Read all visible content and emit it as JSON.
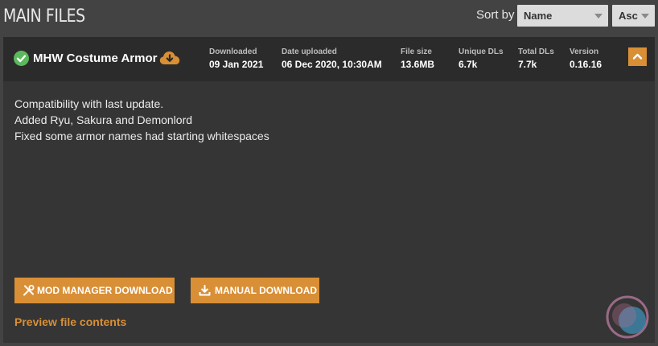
{
  "section": {
    "title": "MAIN FILES"
  },
  "sort": {
    "label": "Sort by",
    "field_selected": "Name",
    "order_selected": "Asc"
  },
  "file": {
    "name": "MHW Costume Armor",
    "stats": [
      {
        "label": "Downloaded",
        "value": "09 Jan 2021"
      },
      {
        "label": "Date uploaded",
        "value": "06 Dec 2020, 10:30AM"
      },
      {
        "label": "File size",
        "value": "13.6MB"
      },
      {
        "label": "Unique DLs",
        "value": "6.7k"
      },
      {
        "label": "Total DLs",
        "value": "7.7k"
      },
      {
        "label": "Version",
        "value": "0.16.16"
      }
    ],
    "description": [
      "Compatibility with last update.",
      "Added Ryu, Sakura and Demonlord",
      "Fixed some armor names had starting whitespaces"
    ]
  },
  "actions": {
    "mod_manager_label": "MOD MANAGER DOWNLOAD",
    "manual_label": "MANUAL DOWNLOAD",
    "preview_label": "Preview file contents"
  },
  "icons": {
    "status": "check-circle-icon",
    "downloaded": "cloud-download-icon",
    "collapse": "chevron-up-icon",
    "mod_manager": "tools-icon",
    "manual": "download-tray-icon"
  },
  "colors": {
    "accent": "#d98f35",
    "success": "#5cb85c",
    "page_bg": "#434343",
    "panel_bg": "#353535",
    "header_bg": "#2b2b2b"
  }
}
